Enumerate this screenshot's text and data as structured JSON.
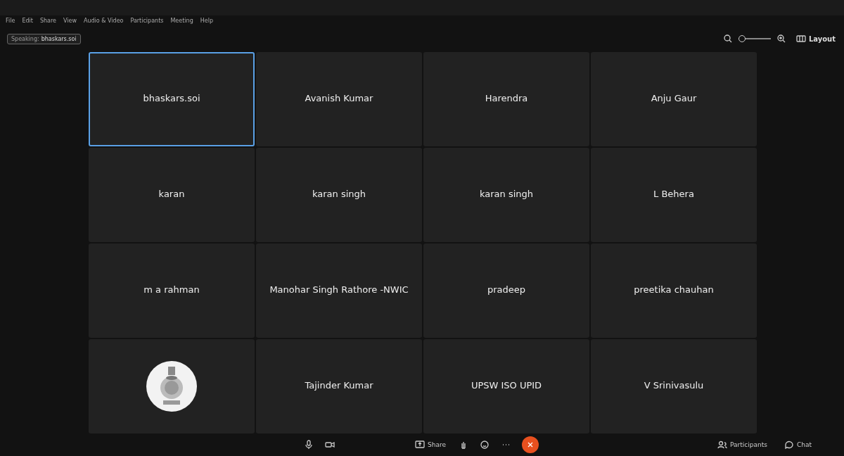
{
  "menu": [
    "File",
    "Edit",
    "Share",
    "View",
    "Audio & Video",
    "Participants",
    "Meeting",
    "Help"
  ],
  "speaking": {
    "label": "Speaking:",
    "name": "bhaskars.soi"
  },
  "zoom": {
    "level": 0.0
  },
  "layout_button": "Layout",
  "tiles": [
    {
      "name": "bhaskars.soi",
      "selected": true,
      "kind": "name"
    },
    {
      "name": "Avanish Kumar",
      "selected": false,
      "kind": "name"
    },
    {
      "name": "Harendra",
      "selected": false,
      "kind": "name"
    },
    {
      "name": "Anju Gaur",
      "selected": false,
      "kind": "name"
    },
    {
      "name": "karan",
      "selected": false,
      "kind": "name"
    },
    {
      "name": "karan singh",
      "selected": false,
      "kind": "name"
    },
    {
      "name": "karan singh",
      "selected": false,
      "kind": "name"
    },
    {
      "name": "L Behera",
      "selected": false,
      "kind": "name"
    },
    {
      "name": "m a rahman",
      "selected": false,
      "kind": "name"
    },
    {
      "name": "Manohar Singh Rathore -NWIC",
      "selected": false,
      "kind": "name"
    },
    {
      "name": "pradeep",
      "selected": false,
      "kind": "name"
    },
    {
      "name": "preetika chauhan",
      "selected": false,
      "kind": "name"
    },
    {
      "kind": "picture",
      "selected": false
    },
    {
      "name": "Tajinder Kumar",
      "selected": false,
      "kind": "name"
    },
    {
      "name": "UPSW ISO UPID",
      "selected": false,
      "kind": "name"
    },
    {
      "name": "V Srinivasulu",
      "selected": false,
      "kind": "name"
    }
  ],
  "toolbar": {
    "share": "Share",
    "participants": "Participants",
    "chat": "Chat"
  }
}
